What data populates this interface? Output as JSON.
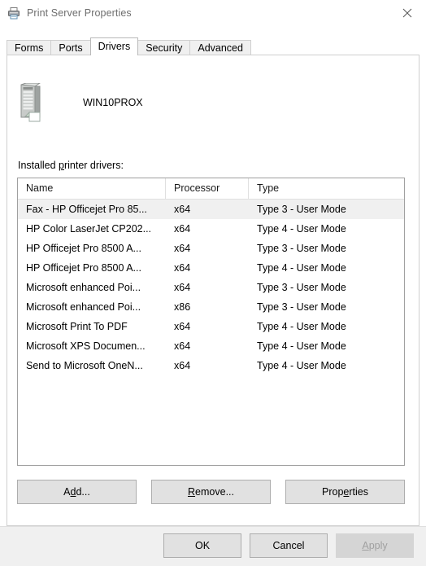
{
  "window": {
    "title": "Print Server Properties",
    "title_icon": "printer-icon",
    "close_icon": "close-icon",
    "title_color": "#6e6e6e"
  },
  "tabs": [
    {
      "label": "Forms",
      "active": false
    },
    {
      "label": "Ports",
      "active": false
    },
    {
      "label": "Drivers",
      "active": true
    },
    {
      "label": "Security",
      "active": false
    },
    {
      "label": "Advanced",
      "active": false
    }
  ],
  "server": {
    "icon": "server-tower-icon",
    "name": "WIN10PROX"
  },
  "drivers_section": {
    "label_before": "Installed ",
    "label_accel": "p",
    "label_after": "rinter drivers:"
  },
  "list": {
    "columns": [
      "Name",
      "Processor",
      "Type"
    ],
    "rows": [
      {
        "name": "Fax - HP Officejet Pro 85...",
        "processor": "x64",
        "type": "Type 3 - User Mode",
        "selected": true
      },
      {
        "name": "HP Color LaserJet CP202...",
        "processor": "x64",
        "type": "Type 4 - User Mode",
        "selected": false
      },
      {
        "name": "HP Officejet Pro 8500 A...",
        "processor": "x64",
        "type": "Type 3 - User Mode",
        "selected": false
      },
      {
        "name": "HP Officejet Pro 8500 A...",
        "processor": "x64",
        "type": "Type 4 - User Mode",
        "selected": false
      },
      {
        "name": "Microsoft enhanced Poi...",
        "processor": "x64",
        "type": "Type 3 - User Mode",
        "selected": false
      },
      {
        "name": "Microsoft enhanced Poi...",
        "processor": "x86",
        "type": "Type 3 - User Mode",
        "selected": false
      },
      {
        "name": "Microsoft Print To PDF",
        "processor": "x64",
        "type": "Type 4 - User Mode",
        "selected": false
      },
      {
        "name": "Microsoft XPS Documen...",
        "processor": "x64",
        "type": "Type 4 - User Mode",
        "selected": false
      },
      {
        "name": "Send to Microsoft OneN...",
        "processor": "x64",
        "type": "Type 4 - User Mode",
        "selected": false
      }
    ]
  },
  "actions": {
    "add": {
      "before": "A",
      "accel": "d",
      "after": "d..."
    },
    "remove": {
      "before": "",
      "accel": "R",
      "after": "emove..."
    },
    "properties": {
      "before": "Prop",
      "accel": "e",
      "after": "rties"
    }
  },
  "footer": {
    "ok": "OK",
    "cancel": "Cancel",
    "apply": {
      "before": "",
      "accel": "A",
      "after": "pply"
    },
    "apply_disabled": true
  }
}
